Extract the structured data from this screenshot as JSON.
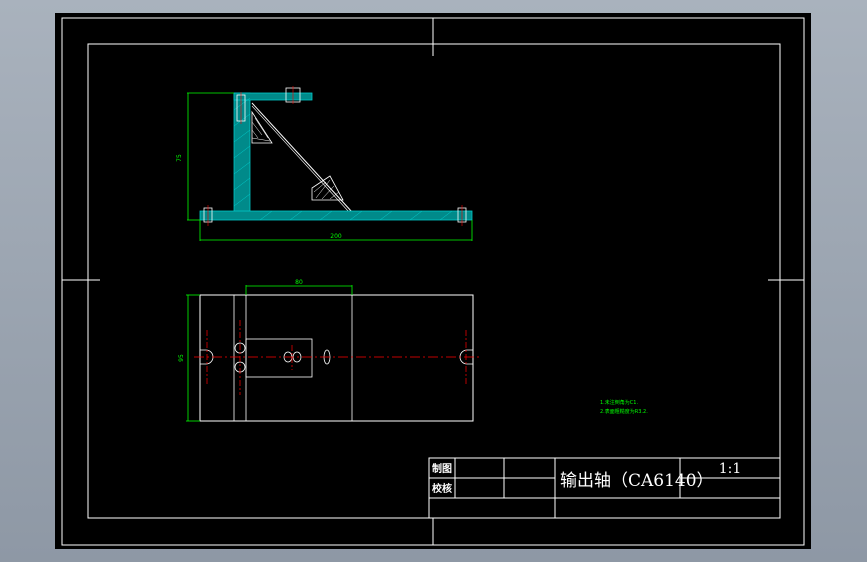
{
  "title_block": {
    "drawn_label": "制图",
    "checked_label": "校核",
    "title": "输出轴（CA6140）",
    "scale": "1:1"
  },
  "notes": {
    "line1": "1.未注倒角为C1.",
    "line2": "2.表面粗糙度为R3.2."
  },
  "dimensions": {
    "height": "75",
    "length": "200",
    "slot_width": "80",
    "base_width": "95"
  },
  "colors": {
    "background": "#000000",
    "frame": "#ffffff",
    "dimension": "#00ff00",
    "centerline": "#ff0000",
    "section": "#00b0b0",
    "hatch": "#ffffff",
    "note": "#00ff00"
  }
}
